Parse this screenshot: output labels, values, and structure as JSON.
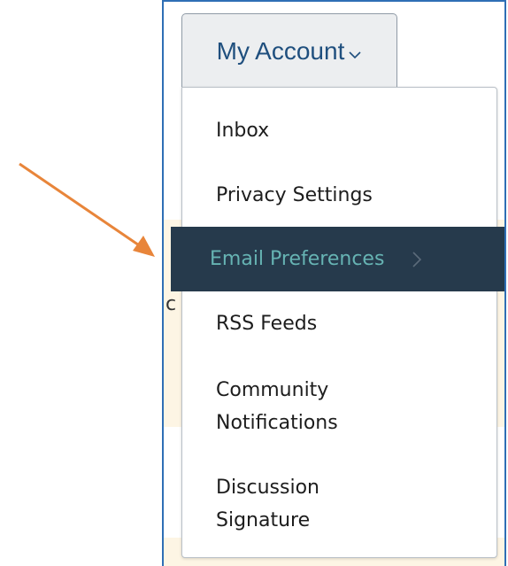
{
  "account_button": {
    "label": "My Account",
    "icon": "chevron-down-icon",
    "text_color": "#1f4f7e"
  },
  "dropdown": {
    "items": [
      {
        "label": "Inbox"
      },
      {
        "label": "Privacy Settings"
      },
      {
        "label": "Email Preferences",
        "active": true,
        "icon": "chevron-right-icon"
      },
      {
        "label": "RSS Feeds"
      },
      {
        "label": "Community\nNotifications"
      },
      {
        "label": "Discussion\nSignature"
      }
    ],
    "active_bg": "#263a4c",
    "active_text": "#66b3b3"
  },
  "background": {
    "partial_text": "c",
    "band_color": "#fdf5e4"
  },
  "annotation": {
    "type": "arrow",
    "color": "#e8853a"
  },
  "frame_border_color": "#2f6fb5"
}
